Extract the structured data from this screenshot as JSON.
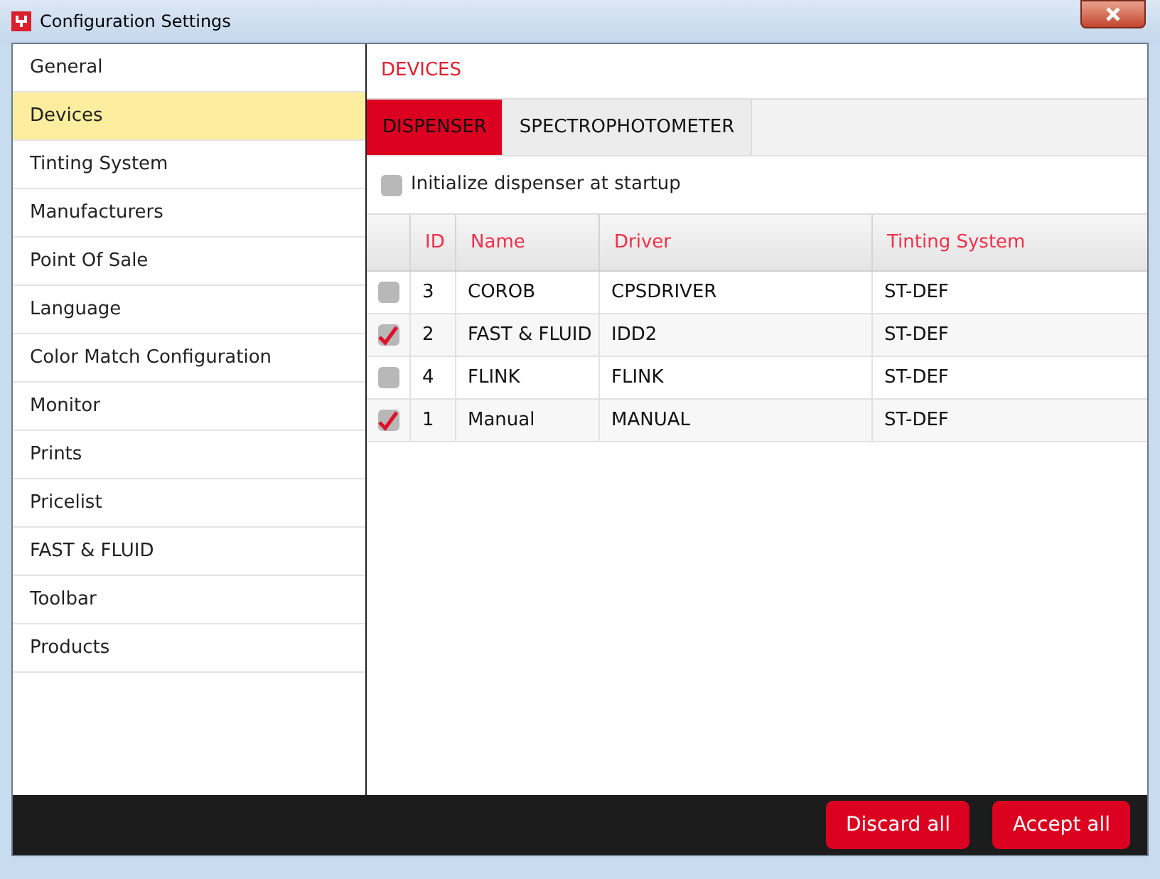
{
  "window": {
    "title": "Configuration Settings"
  },
  "sidebar": {
    "items": [
      {
        "label": "General",
        "selected": false
      },
      {
        "label": "Devices",
        "selected": true
      },
      {
        "label": "Tinting System",
        "selected": false
      },
      {
        "label": "Manufacturers",
        "selected": false
      },
      {
        "label": "Point Of Sale",
        "selected": false
      },
      {
        "label": "Language",
        "selected": false
      },
      {
        "label": "Color Match Configuration",
        "selected": false
      },
      {
        "label": "Monitor",
        "selected": false
      },
      {
        "label": "Prints",
        "selected": false
      },
      {
        "label": "Pricelist",
        "selected": false
      },
      {
        "label": "FAST & FLUID",
        "selected": false
      },
      {
        "label": "Toolbar",
        "selected": false
      },
      {
        "label": "Products",
        "selected": false
      }
    ]
  },
  "section_title": "DEVICES",
  "tabs": [
    {
      "label": "DISPENSER",
      "selected": true
    },
    {
      "label": "SPECTROPHOTOMETER",
      "selected": false
    }
  ],
  "init_option": {
    "label": "Initialize dispenser at startup",
    "checked": false
  },
  "table": {
    "columns": [
      "ID",
      "Name",
      "Driver",
      "Tinting System"
    ],
    "rows": [
      {
        "checked": false,
        "cells": [
          "3",
          "COROB",
          "CPSDRIVER",
          "ST-DEF"
        ]
      },
      {
        "checked": true,
        "cells": [
          "2",
          "FAST & FLUID",
          "IDD2",
          "ST-DEF"
        ]
      },
      {
        "checked": false,
        "cells": [
          "4",
          "FLINK",
          "FLINK",
          "ST-DEF"
        ]
      },
      {
        "checked": true,
        "cells": [
          "1",
          "Manual",
          "MANUAL",
          "ST-DEF"
        ]
      }
    ]
  },
  "buttons": [
    "Discard all",
    "Accept all"
  ]
}
